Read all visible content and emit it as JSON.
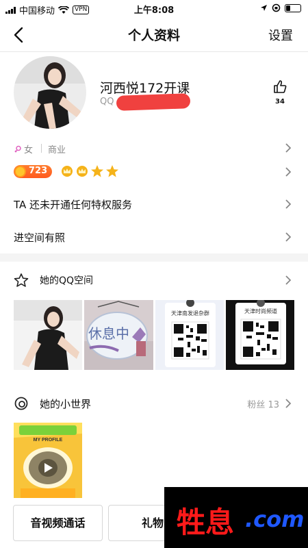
{
  "status_bar": {
    "carrier": "中国移动",
    "vpn": "VPN",
    "time": "上午8:08"
  },
  "nav": {
    "title": "个人资料",
    "settings_label": "设置"
  },
  "profile": {
    "name": "河西悦172开课",
    "qq_label": "QQ",
    "likes": "34"
  },
  "tags": {
    "gender": "女",
    "occupation": "商业"
  },
  "level": {
    "value": "723",
    "crown_count": 4
  },
  "rows": [
    {
      "label": "TA 还未开通任何特权服务"
    },
    {
      "label": "进空间有照"
    }
  ],
  "qzone": {
    "title": "她的QQ空间",
    "photos": [
      {
        "kind": "photo-woman"
      },
      {
        "kind": "photo-sign",
        "sign_text": "休息中"
      },
      {
        "kind": "qr-card",
        "title": "天津南发退杂群"
      },
      {
        "kind": "qr-card",
        "title": "天津时尚频道"
      }
    ]
  },
  "world": {
    "title": "她的小世界",
    "fans_label": "粉丝 13",
    "video_banner": "MY PROFILE"
  },
  "buttons": {
    "av_call": "音视频通话",
    "gift": "礼物"
  },
  "watermark": {
    "cn": "牲息",
    "en": ".com"
  },
  "colors": {
    "accent": "#f0413f",
    "level_orange": "#ff6a1f",
    "crown_gold": "#f5b31a"
  }
}
